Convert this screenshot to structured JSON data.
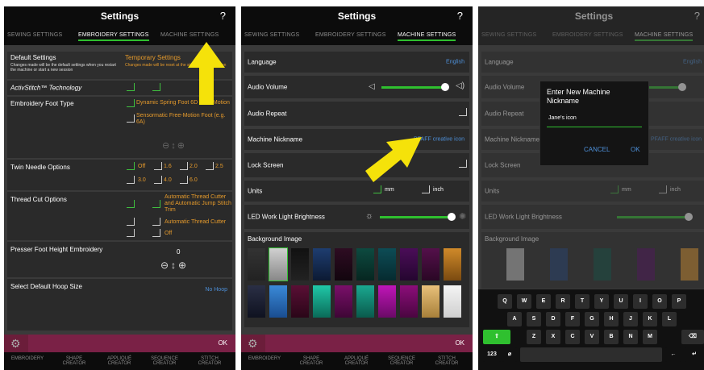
{
  "common": {
    "title": "Settings",
    "help": "?",
    "tabs": [
      "SEWING SETTINGS",
      "EMBROIDERY SETTINGS",
      "MACHINE SETTINGS"
    ],
    "ok": "OK",
    "footer": [
      "EMBROIDERY",
      "SHAPE CREATOR",
      "APPLIQUÉ CREATOR",
      "SEQUENCE CREATOR",
      "STITCH CREATOR"
    ]
  },
  "panel1": {
    "default_settings": "Default Settings",
    "default_desc": "Changes made will be the default settings when you restart the machine or start a new session",
    "temporary_settings": "Temporary Settings",
    "temporary_desc": "Changes made will be reset at the start of a new session",
    "activstitch": "ActivStitch™ Technology",
    "foot_type": "Embroidery Foot Type",
    "foot_opt1": "Dynamic Spring Foot 6D Free-Motion",
    "foot_opt2": "Sensormatic Free-Motion Foot (e.g. 6A)",
    "twin_needle": "Twin Needle Options",
    "twin_vals": [
      "Off",
      "1.6",
      "2.0",
      "2.5",
      "3.0",
      "4.0",
      "6.0"
    ],
    "thread_cut": "Thread Cut Options",
    "thread_opt1": "Automatic Thread Cutter and Automatic Jump Stitch Trim",
    "thread_opt2": "Automatic Thread Cutter",
    "thread_opt3": "Off",
    "presser_foot": "Presser Foot Height Embroidery",
    "presser_val": "0",
    "hoop_size": "Select Default Hoop Size",
    "hoop_val": "No Hoop"
  },
  "panel2": {
    "language": "Language",
    "language_val": "English",
    "audio_volume": "Audio Volume",
    "audio_repeat": "Audio Repeat",
    "nickname": "Machine Nickname",
    "nickname_val": "PFAFF creative icon",
    "lock_screen": "Lock Screen",
    "units": "Units",
    "unit_mm": "mm",
    "unit_inch": "inch",
    "led": "LED Work Light Brightness",
    "background": "Background Image"
  },
  "panel3": {
    "dialog_title": "Enter New Machine Nickname",
    "input_value": "Jane's icon",
    "cancel": "CANCEL",
    "ok": "OK",
    "keys_row1": [
      "Q",
      "W",
      "E",
      "R",
      "T",
      "Y",
      "U",
      "I",
      "O",
      "P"
    ],
    "keys_row2": [
      "A",
      "S",
      "D",
      "F",
      "G",
      "H",
      "J",
      "K",
      "L"
    ],
    "keys_row3": [
      "Z",
      "X",
      "C",
      "V",
      "B",
      "N",
      "M"
    ],
    "key_123": "123"
  },
  "colors": {
    "accent_green": "#2fc02f",
    "orange": "#e59a2c",
    "link_blue": "#4d8fd8",
    "bar_magenta": "#6b1d3a",
    "arrow_yellow": "#f5e20a"
  }
}
